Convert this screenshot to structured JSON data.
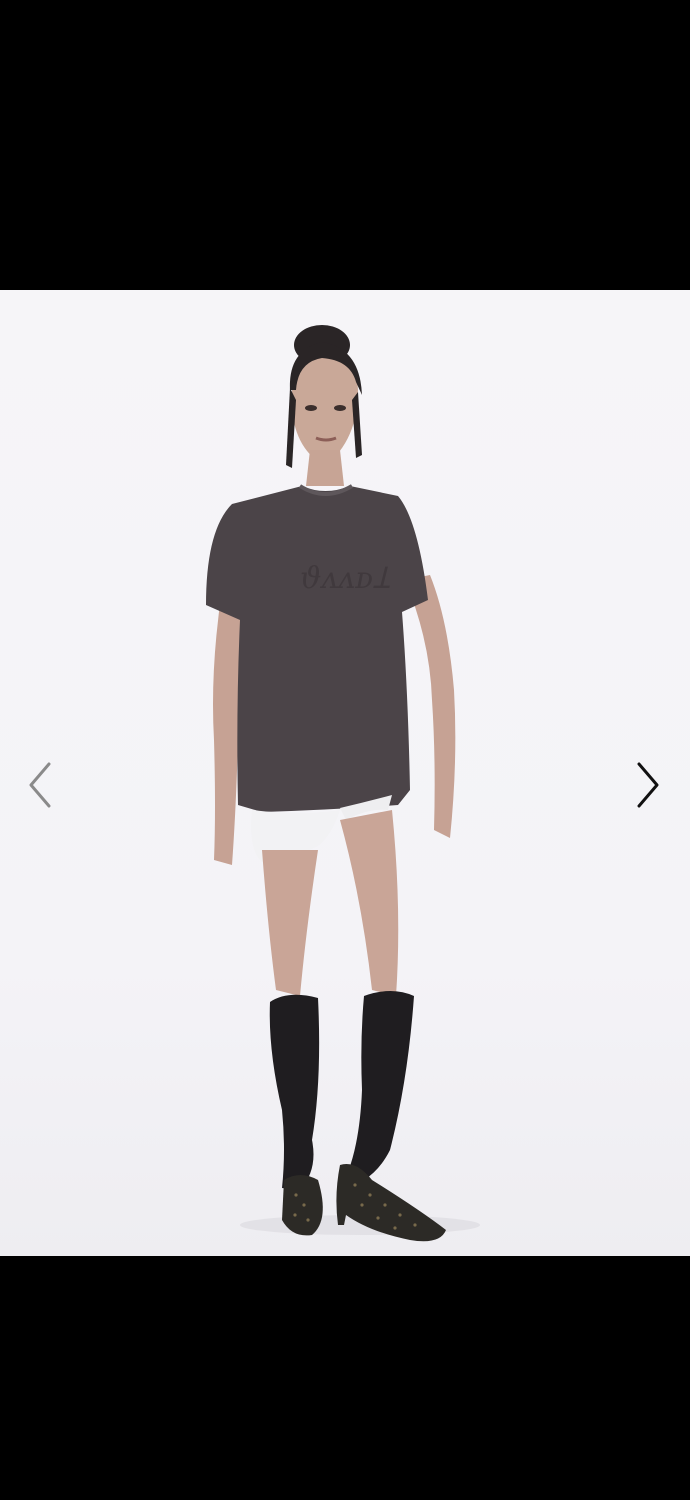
{
  "viewer": {
    "background": "#000000",
    "photo_background": "#f5f4f7"
  },
  "gallery": {
    "prev_icon": "chevron-left-icon",
    "next_icon": "chevron-right-icon",
    "prev_color": "#8a8a8a",
    "next_color": "#111111"
  },
  "photo": {
    "subject": "model-in-grey-tshirt-and-knee-socks"
  }
}
